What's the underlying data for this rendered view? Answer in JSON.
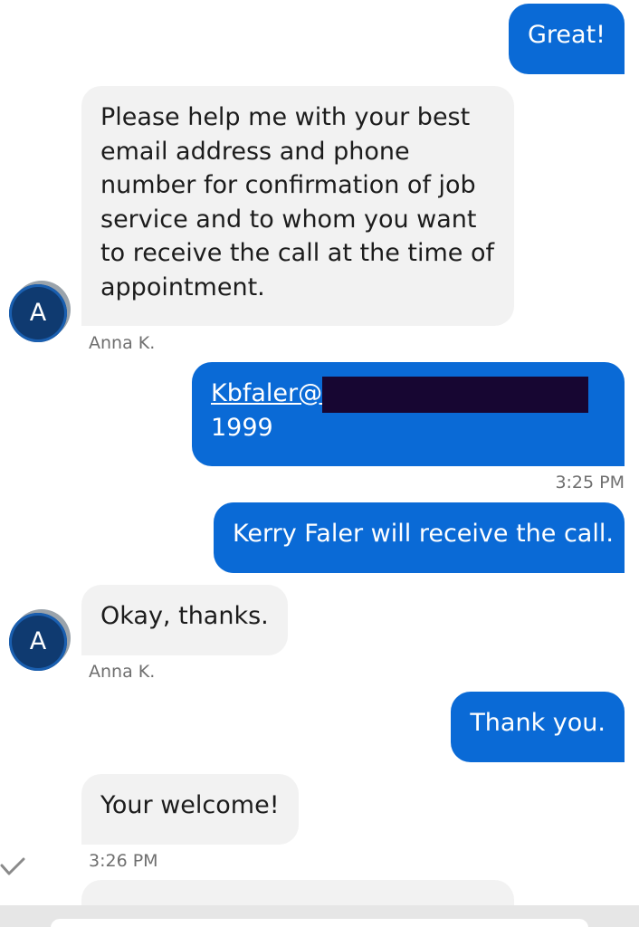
{
  "messages": {
    "m1": {
      "lines": [
        "Great!"
      ]
    },
    "m2": {
      "lines": [
        "Please help me with your best",
        "email address and phone",
        "number for confirmation of job",
        "service and to whom you want",
        "to receive the call at the time of",
        "appointment."
      ],
      "sender": "Anna K.",
      "avatar_initial": "A"
    },
    "m3": {
      "link": "Kbfaler@",
      "line2": "1999",
      "time": "3:25 PM"
    },
    "m4": {
      "lines": [
        "Kerry Faler will receive the call."
      ]
    },
    "m5": {
      "lines": [
        "Okay, thanks."
      ],
      "sender": "Anna K.",
      "avatar_initial": "A"
    },
    "m6": {
      "lines": [
        "Thank you."
      ]
    },
    "m7": {
      "lines": [
        "Your welcome!"
      ],
      "time": "3:26 PM"
    }
  },
  "icons": {
    "delivered": "checkmark-icon"
  },
  "colors": {
    "outgoing_bubble": "#0a6ad6",
    "incoming_bubble": "#f2f2f2",
    "avatar": "#0f3a70",
    "redaction": "#170632"
  }
}
